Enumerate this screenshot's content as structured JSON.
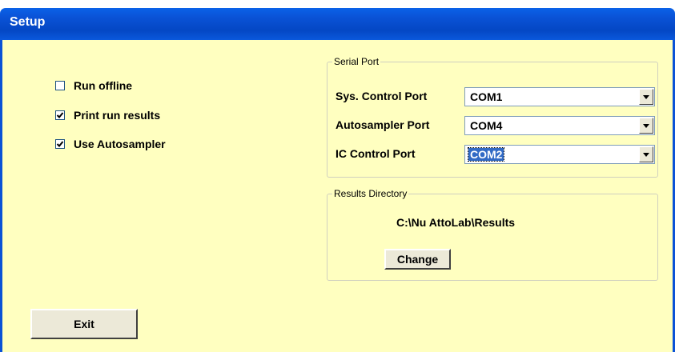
{
  "window": {
    "title": "Setup"
  },
  "options": [
    {
      "label": "Run offline",
      "checked": false
    },
    {
      "label": "Print run results",
      "checked": true
    },
    {
      "label": "Use Autosampler",
      "checked": true
    }
  ],
  "serial_port": {
    "legend": "Serial Port",
    "ports": [
      {
        "label": "Sys. Control Port",
        "value": "COM1"
      },
      {
        "label": "Autosampler Port",
        "value": "COM4"
      },
      {
        "label": "IC Control Port",
        "value": "COM2"
      }
    ]
  },
  "results": {
    "legend": "Results Directory",
    "path": "C:\\Nu AttoLab\\Results",
    "change_label": "Change"
  },
  "exit_label": "Exit",
  "colors": {
    "client_bg": "#ffffc0",
    "titlebar": "#0a52d6",
    "selection": "#316ac5"
  }
}
